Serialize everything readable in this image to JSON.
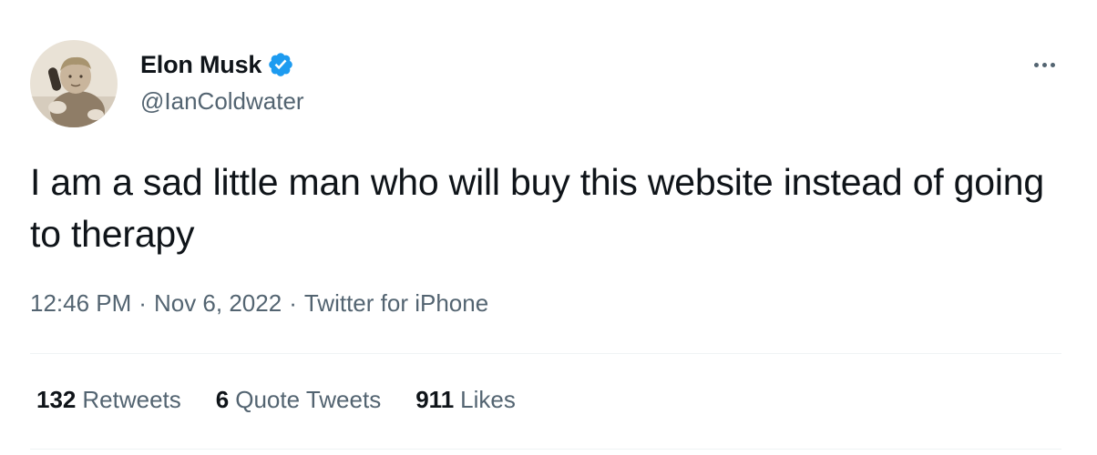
{
  "tweet": {
    "author": {
      "display_name": "Elon Musk",
      "handle": "@IanColdwater",
      "verified": true,
      "avatar_icon": "profile-photo-child-on-phone"
    },
    "text": "I am a sad little man who will buy this website instead of going to therapy",
    "meta": {
      "time": "12:46 PM",
      "separator": "·",
      "date": "Nov 6, 2022",
      "source": "Twitter for iPhone"
    },
    "stats": [
      {
        "count": "132",
        "label": "Retweets"
      },
      {
        "count": "6",
        "label": "Quote Tweets"
      },
      {
        "count": "911",
        "label": "Likes"
      }
    ],
    "more_icon": "more-horizontal-icon"
  },
  "colors": {
    "text_primary": "#0f1419",
    "text_secondary": "#536471",
    "verified_blue": "#1d9bf0",
    "divider": "#eff3f4"
  }
}
